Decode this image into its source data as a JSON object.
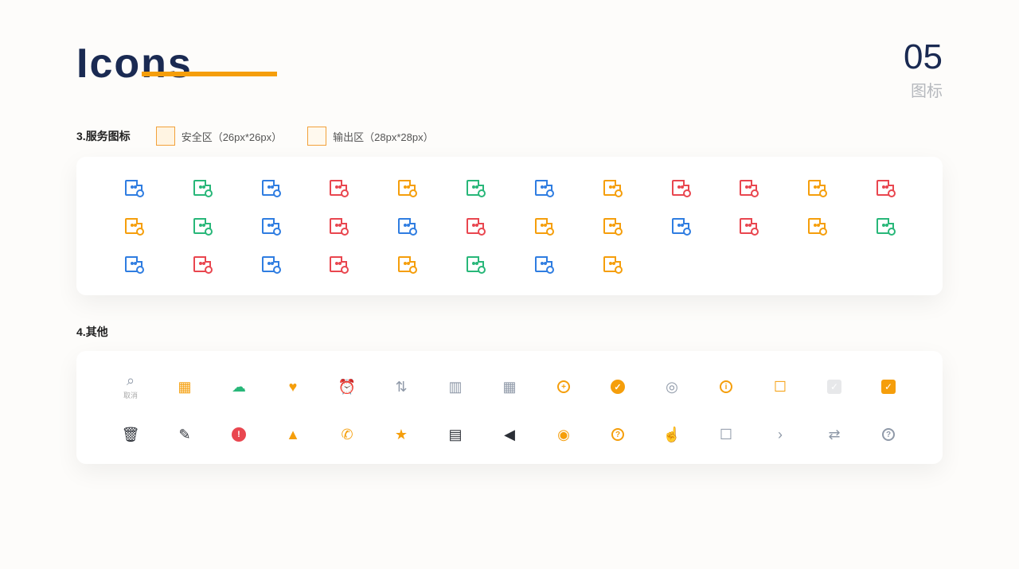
{
  "header": {
    "title": "Icons",
    "page_number": "05",
    "page_caption": "图标"
  },
  "sections": {
    "service": {
      "index": "3.",
      "title": "服务图标",
      "legend_safe": "安全区（26px*26px）",
      "legend_output": "输出区（28px*28px）"
    },
    "other": {
      "index": "4.",
      "title": "其他"
    }
  },
  "service_icons": [
    {
      "name": "doc-search",
      "color": "blue"
    },
    {
      "name": "doc-refresh",
      "color": "green"
    },
    {
      "name": "doc-close",
      "color": "blue"
    },
    {
      "name": "card-delete",
      "color": "red"
    },
    {
      "name": "card-config",
      "color": "orange"
    },
    {
      "name": "doc-time",
      "color": "green"
    },
    {
      "name": "doc-list",
      "color": "blue"
    },
    {
      "name": "card-add",
      "color": "orange"
    },
    {
      "name": "card-flag",
      "color": "red"
    },
    {
      "name": "card-verified",
      "color": "red"
    },
    {
      "name": "card-return",
      "color": "orange"
    },
    {
      "name": "card-edit",
      "color": "red"
    },
    {
      "name": "note-edit",
      "color": "orange"
    },
    {
      "name": "doc-shield",
      "color": "green"
    },
    {
      "name": "doc-share",
      "color": "blue"
    },
    {
      "name": "card-spark",
      "color": "red"
    },
    {
      "name": "card-search",
      "color": "blue"
    },
    {
      "name": "doc-pin",
      "color": "red"
    },
    {
      "name": "card-coin",
      "color": "orange"
    },
    {
      "name": "card-fire",
      "color": "orange"
    },
    {
      "name": "card-download",
      "color": "blue"
    },
    {
      "name": "card-upload",
      "color": "red"
    },
    {
      "name": "card-approve",
      "color": "orange"
    },
    {
      "name": "card-new",
      "color": "green"
    },
    {
      "name": "list-card",
      "color": "blue"
    },
    {
      "name": "card-remove",
      "color": "red"
    },
    {
      "name": "card-minus",
      "color": "blue"
    },
    {
      "name": "doc-stamp",
      "color": "red"
    },
    {
      "name": "note-text",
      "color": "orange"
    },
    {
      "name": "note-sync",
      "color": "green"
    },
    {
      "name": "briefcase",
      "color": "blue"
    },
    {
      "name": "card-forward",
      "color": "orange"
    }
  ],
  "other_icons": [
    {
      "name": "search",
      "label": "取消",
      "color": "gray",
      "glyph": "⌕"
    },
    {
      "name": "qr-code",
      "color": "orange",
      "glyph": "▦"
    },
    {
      "name": "wechat",
      "color": "green",
      "glyph": "☁"
    },
    {
      "name": "heart",
      "color": "orange",
      "glyph": "♥"
    },
    {
      "name": "alarm-clock",
      "color": "black",
      "glyph": "⏰"
    },
    {
      "name": "sort",
      "color": "gray",
      "glyph": "⇅"
    },
    {
      "name": "bar-chart",
      "color": "gray",
      "glyph": "▥"
    },
    {
      "name": "calendar",
      "color": "gray",
      "glyph": "▦"
    },
    {
      "name": "add-circle",
      "color": "orange",
      "glyph": "+"
    },
    {
      "name": "check-circle-fill",
      "color": "orange",
      "glyph": "✓"
    },
    {
      "name": "location-pin",
      "color": "gray",
      "glyph": "◎"
    },
    {
      "name": "info-circle",
      "color": "orange",
      "glyph": "i"
    },
    {
      "name": "briefcase",
      "color": "orange",
      "glyph": "☐"
    },
    {
      "name": "checkbox-off",
      "color": "gray",
      "glyph": "✓"
    },
    {
      "name": "checkbox-on",
      "color": "orange",
      "glyph": "✓"
    },
    {
      "name": "trash",
      "color": "black",
      "glyph": "🗑"
    },
    {
      "name": "edit",
      "color": "black",
      "glyph": "✎"
    },
    {
      "name": "alert-fill",
      "color": "red",
      "glyph": "!"
    },
    {
      "name": "fire",
      "color": "orange",
      "glyph": "▲"
    },
    {
      "name": "phone",
      "color": "orange",
      "glyph": "✆"
    },
    {
      "name": "star-fill",
      "color": "orange",
      "glyph": "★"
    },
    {
      "name": "save",
      "color": "black",
      "glyph": "▤"
    },
    {
      "name": "volume",
      "color": "black",
      "glyph": "◀"
    },
    {
      "name": "eye",
      "color": "orange",
      "glyph": "◉"
    },
    {
      "name": "help-circle",
      "color": "orange",
      "glyph": "?"
    },
    {
      "name": "thumbs-up",
      "color": "gray",
      "glyph": "☝"
    },
    {
      "name": "message",
      "color": "gray",
      "glyph": "☐"
    },
    {
      "name": "chevron-right",
      "color": "gray",
      "glyph": "›"
    },
    {
      "name": "shuffle",
      "color": "gray",
      "glyph": "⇄"
    },
    {
      "name": "help-gray",
      "color": "gray",
      "glyph": "?"
    }
  ]
}
